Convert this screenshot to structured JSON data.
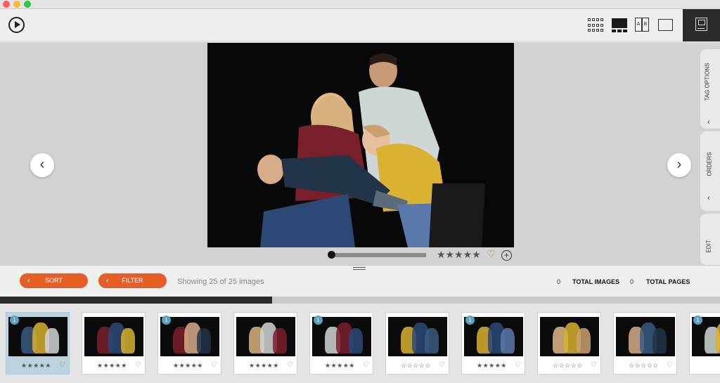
{
  "titlebar": {
    "buttons": [
      {
        "name": "close",
        "color": "#ff5f57"
      },
      {
        "name": "minimize",
        "color": "#febc2e"
      },
      {
        "name": "zoom",
        "color": "#28c840"
      }
    ]
  },
  "toolbar": {
    "play_icon": "play-circle-icon",
    "view_modes": [
      "grid-view",
      "filmstrip-view",
      "compare-view",
      "single-view"
    ],
    "compare_labels": {
      "a": "A",
      "b": "B"
    },
    "panel_icon": "layout-panel-icon"
  },
  "viewer": {
    "prev_glyph": "‹",
    "next_glyph": "›",
    "slider_value": 0,
    "rating_glyphs": "★★★★★",
    "rating": 0,
    "heart_glyph": "♡",
    "add_glyph": "+"
  },
  "side_tabs": [
    {
      "label": "TAG OPTIONS",
      "chevron": "‹"
    },
    {
      "label": "ORDERS",
      "chevron": "‹"
    },
    {
      "label": "EDIT",
      "chevron": ""
    }
  ],
  "controls": {
    "sort_label": "SORT",
    "filter_label": "FILTER",
    "chevron": "‹",
    "showing_text": "Showing 25 of 25 images",
    "total_images_count": "0",
    "total_images_label": "TOTAL IMAGES",
    "total_pages_count": "0",
    "total_pages_label": "TOTAL PAGES"
  },
  "filmstrip": {
    "progress": 0.378,
    "colors": {
      "accent": "#e35f25",
      "badge": "#5aa0c2",
      "selected": "#bcd3df"
    },
    "thumbnails": [
      {
        "badge": "1",
        "stars": "★★★★★",
        "heart": "♡",
        "selected": true
      },
      {
        "badge": "",
        "stars": "★★★★★",
        "heart": "♡",
        "selected": false
      },
      {
        "badge": "1",
        "stars": "★★★★★",
        "heart": "♡",
        "selected": false
      },
      {
        "badge": "",
        "stars": "★★★★★",
        "heart": "♡",
        "selected": false
      },
      {
        "badge": "1",
        "stars": "★★★★★",
        "heart": "♡",
        "selected": false
      },
      {
        "badge": "",
        "stars": "☆☆☆☆☆",
        "heart": "♡",
        "selected": false
      },
      {
        "badge": "1",
        "stars": "★★★★★",
        "heart": "♡",
        "selected": false
      },
      {
        "badge": "",
        "stars": "☆☆☆☆☆",
        "heart": "♡",
        "selected": false
      },
      {
        "badge": "",
        "stars": "☆☆☆☆☆",
        "heart": "♡",
        "selected": false
      },
      {
        "badge": "1",
        "stars": "",
        "heart": "",
        "selected": false
      }
    ]
  }
}
